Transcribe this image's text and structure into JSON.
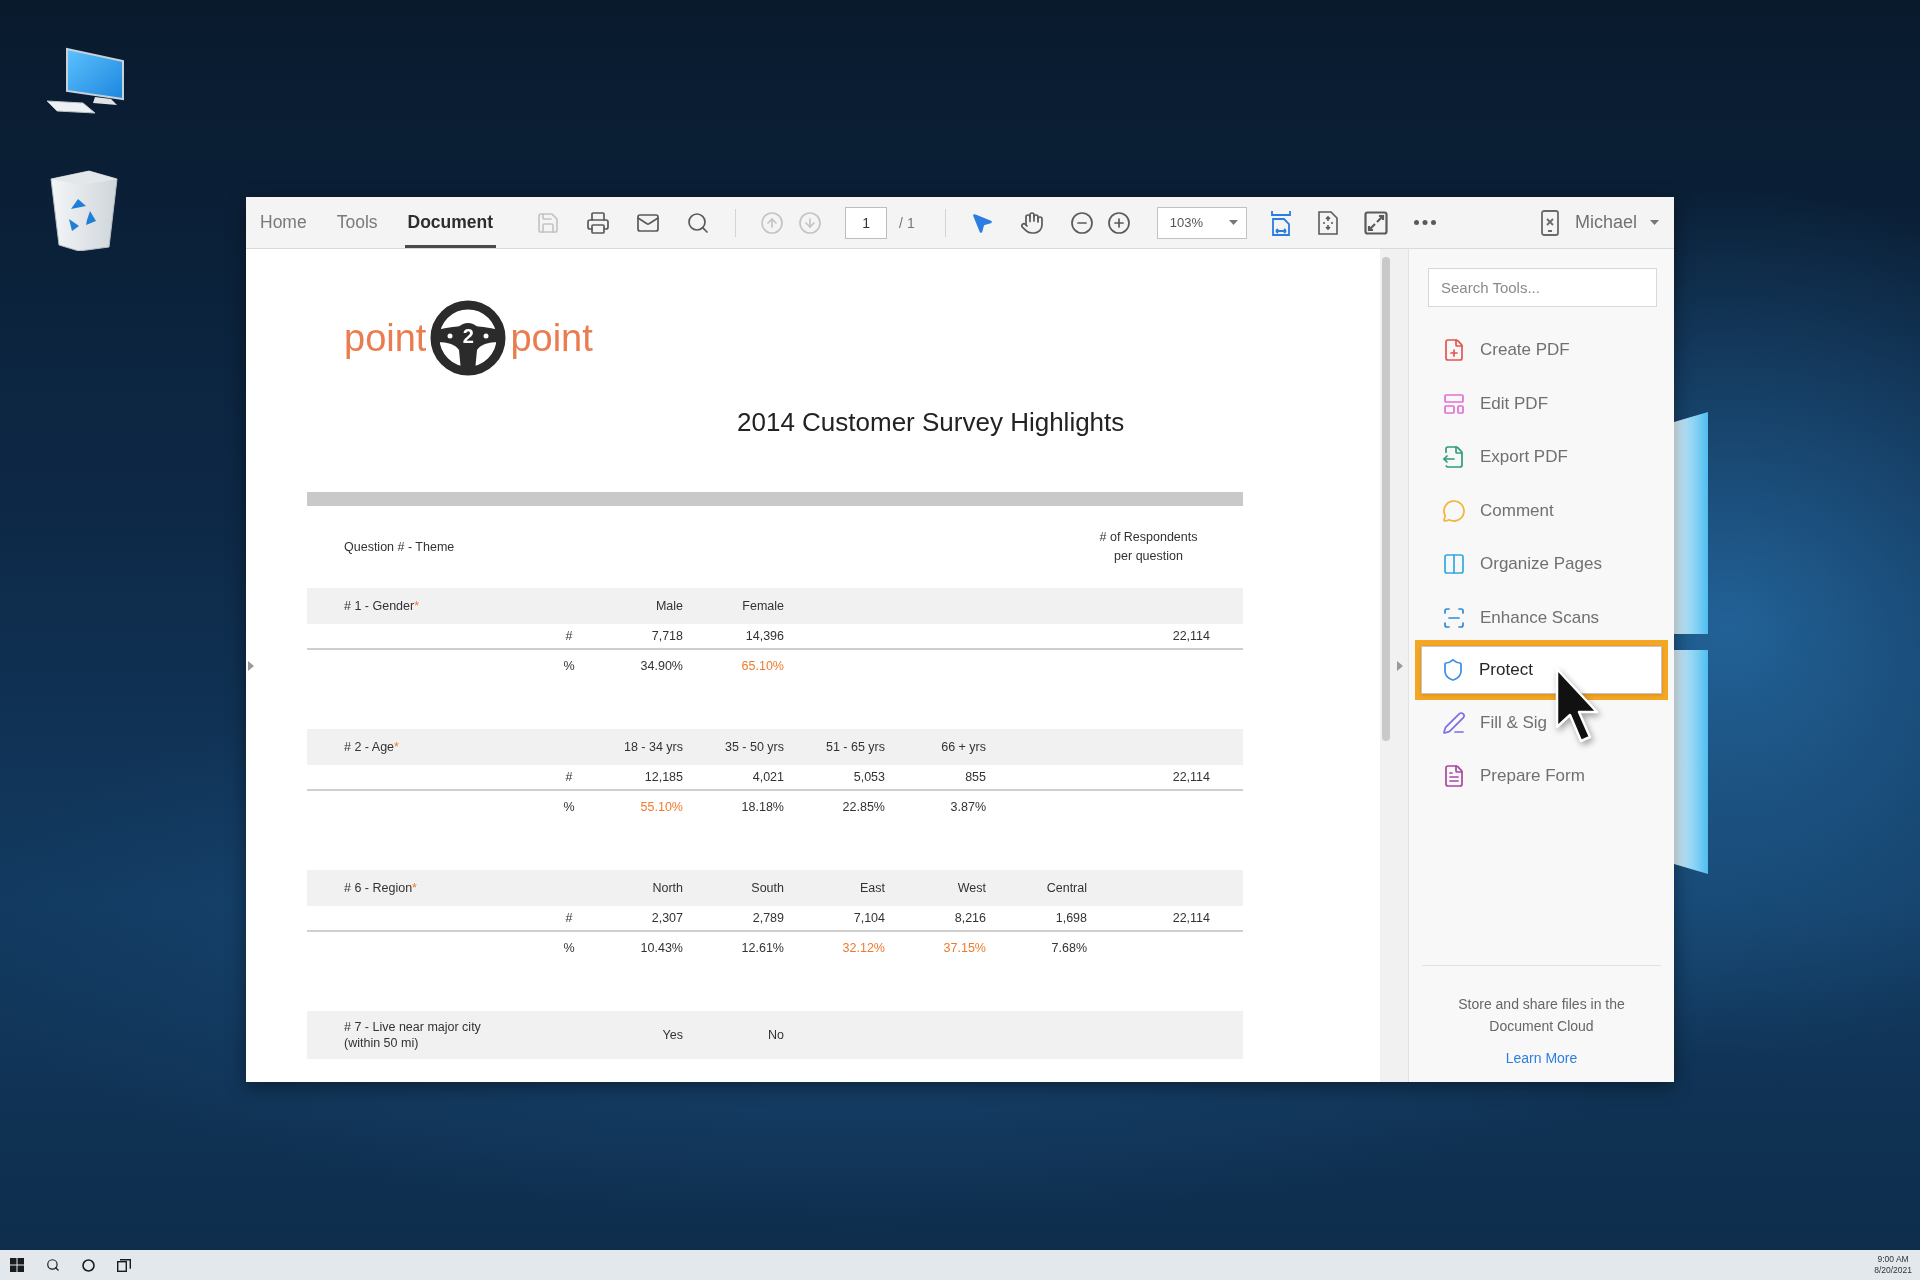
{
  "tabs": [
    {
      "label": "Home",
      "selected": false
    },
    {
      "label": "Tools",
      "selected": false
    },
    {
      "label": "Document",
      "selected": true
    }
  ],
  "toolbar": {
    "file_actions": [
      {
        "kind": "save",
        "disabled": true
      },
      {
        "kind": "print",
        "disabled": false
      },
      {
        "kind": "mail",
        "disabled": false
      },
      {
        "kind": "search",
        "disabled": false
      }
    ],
    "page_buttons": [
      {
        "kind": "previous",
        "disabled": true
      },
      {
        "kind": "next",
        "disabled": true
      }
    ],
    "page": {
      "value": "1",
      "total": "/ 1"
    },
    "view_tools": [
      {
        "kind": "select",
        "selected": true
      },
      {
        "kind": "hand",
        "selected": false
      },
      {
        "kind": "zoom_out",
        "selected": false
      },
      {
        "kind": "zoom_in",
        "selected": false
      }
    ],
    "zoom": {
      "value": "103%"
    },
    "view_modes": [
      {
        "kind": "fit_width",
        "selected": true
      },
      {
        "kind": "fit_page",
        "selected": false
      },
      {
        "kind": "full_screen",
        "selected": false
      },
      {
        "kind": "more",
        "selected": false
      }
    ],
    "account": {
      "name": "Michael"
    }
  },
  "document": {
    "logo": {
      "left": "point",
      "number": "2",
      "right": "point"
    },
    "title": "2014 Customer Survey Highlights",
    "table": {
      "theme_heading": "Question # - Theme",
      "respondents_heading": [
        "# of Respondents",
        "per question"
      ],
      "sections": [
        {
          "title_lines": [
            "# 1 - Gender"
          ],
          "mark": "*",
          "columns": [
            "Male",
            "Female"
          ],
          "rows": [
            {
              "symbol": "#",
              "values": [
                {
                  "text": "7,718",
                  "highlight": false
                },
                {
                  "text": "14,396",
                  "highlight": false
                }
              ],
              "total": "22,114"
            },
            {
              "symbol": "%",
              "values": [
                {
                  "text": "34.90%",
                  "highlight": false
                },
                {
                  "text": "65.10%",
                  "highlight": true
                }
              ]
            }
          ]
        },
        {
          "title_lines": [
            "# 2 - Age"
          ],
          "mark": "*",
          "columns": [
            "18 - 34 yrs",
            "35 - 50 yrs",
            "51 - 65 yrs",
            "66 + yrs"
          ],
          "rows": [
            {
              "symbol": "#",
              "values": [
                {
                  "text": "12,185",
                  "highlight": false
                },
                {
                  "text": "4,021",
                  "highlight": false
                },
                {
                  "text": "5,053",
                  "highlight": false
                },
                {
                  "text": "855",
                  "highlight": false
                }
              ],
              "total": "22,114"
            },
            {
              "symbol": "%",
              "values": [
                {
                  "text": "55.10%",
                  "highlight": true
                },
                {
                  "text": "18.18%",
                  "highlight": false
                },
                {
                  "text": "22.85%",
                  "highlight": false
                },
                {
                  "text": "3.87%",
                  "highlight": false
                }
              ]
            }
          ]
        },
        {
          "title_lines": [
            "# 6 - Region"
          ],
          "mark": "*",
          "columns": [
            "North",
            "South",
            "East",
            "West",
            "Central"
          ],
          "rows": [
            {
              "symbol": "#",
              "values": [
                {
                  "text": "2,307",
                  "highlight": false
                },
                {
                  "text": "2,789",
                  "highlight": false
                },
                {
                  "text": "7,104",
                  "highlight": false
                },
                {
                  "text": "8,216",
                  "highlight": false
                },
                {
                  "text": "1,698",
                  "highlight": false
                }
              ],
              "total": "22,114"
            },
            {
              "symbol": "%",
              "values": [
                {
                  "text": "10.43%",
                  "highlight": false
                },
                {
                  "text": "12.61%",
                  "highlight": false
                },
                {
                  "text": "32.12%",
                  "highlight": true
                },
                {
                  "text": "37.15%",
                  "highlight": true
                },
                {
                  "text": "7.68%",
                  "highlight": false
                }
              ]
            }
          ]
        },
        {
          "title_lines": [
            "# 7 - Live near major city",
            "(within 50 mi)"
          ],
          "columns": [
            "Yes",
            "No"
          ]
        }
      ]
    }
  },
  "tools_panel": {
    "search": {
      "placeholder": "Search Tools..."
    },
    "items": [
      {
        "kind": "create",
        "label": "Create PDF",
        "selected": false
      },
      {
        "kind": "edit",
        "label": "Edit PDF",
        "selected": false
      },
      {
        "kind": "export",
        "label": "Export PDF",
        "selected": false
      },
      {
        "kind": "comment",
        "label": "Comment",
        "selected": false
      },
      {
        "kind": "organize",
        "label": "Organize Pages",
        "selected": false
      },
      {
        "kind": "enhance",
        "label": "Enhance Scans",
        "selected": false
      },
      {
        "kind": "protect",
        "label": "Protect",
        "selected": true
      },
      {
        "kind": "sign",
        "label": "Fill & Sig",
        "selected": false
      },
      {
        "kind": "form",
        "label": "Prepare Form",
        "selected": false
      }
    ],
    "cloud": {
      "text_lines": [
        "Store and share files in the",
        "Document Cloud"
      ],
      "link": "Learn More"
    }
  },
  "taskbar": {
    "time": "9:00 AM",
    "date": "8/20/2021"
  }
}
